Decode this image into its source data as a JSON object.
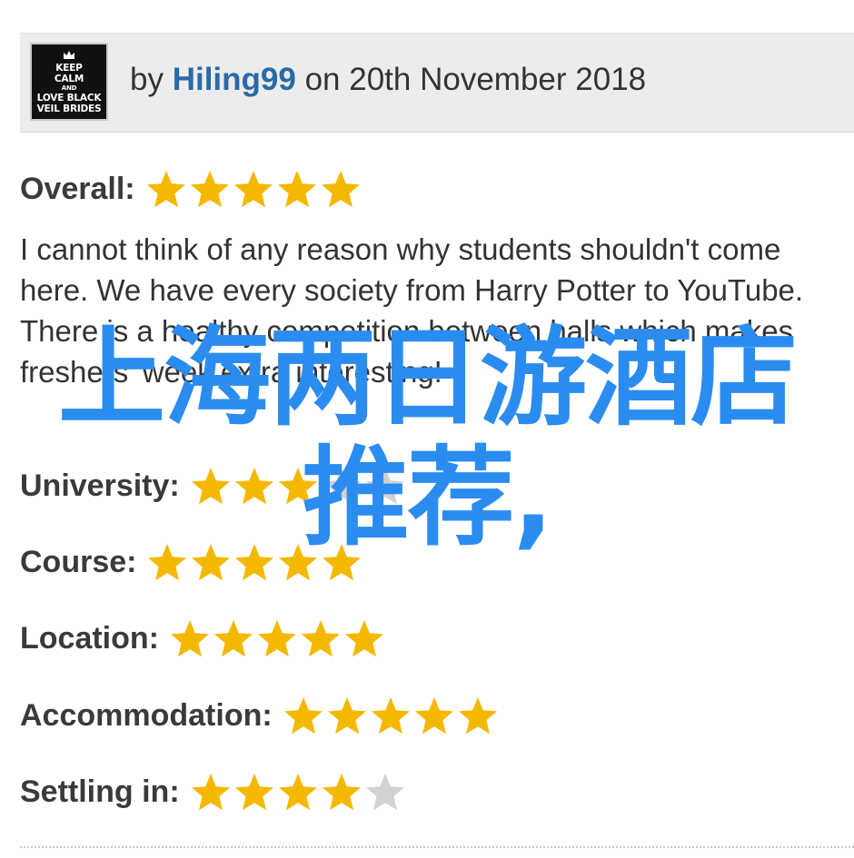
{
  "review": {
    "avatar_text": [
      "KEEP",
      "CALM",
      "AND",
      "LOVE BLACK",
      "VEIL BRIDES"
    ],
    "by_prefix": "by",
    "username": "Hiling99",
    "date_prefix": "on",
    "date": "20th November 2018",
    "overall_label": "Overall:",
    "overall_stars": 5,
    "body": "I cannot think of any reason why students shouldn't come here. We have every society from Harry Potter to YouTube. There is a healthy competition between halls which makes freshers' week extra interesting!"
  },
  "ratings": [
    {
      "label": "University:",
      "stars": 3
    },
    {
      "label": "Course:",
      "stars": 5
    },
    {
      "label": "Location:",
      "stars": 5
    },
    {
      "label": "Accommodation:",
      "stars": 5
    },
    {
      "label": "Settling in:",
      "stars": 4
    }
  ],
  "watermark": {
    "line1": "上海两日游酒店",
    "line2": "推荐,"
  },
  "colors": {
    "star_filled": "#f5b800",
    "star_empty": "#d2d2d2",
    "username": "#2a6aa6",
    "watermark": "#2b8cf0"
  }
}
